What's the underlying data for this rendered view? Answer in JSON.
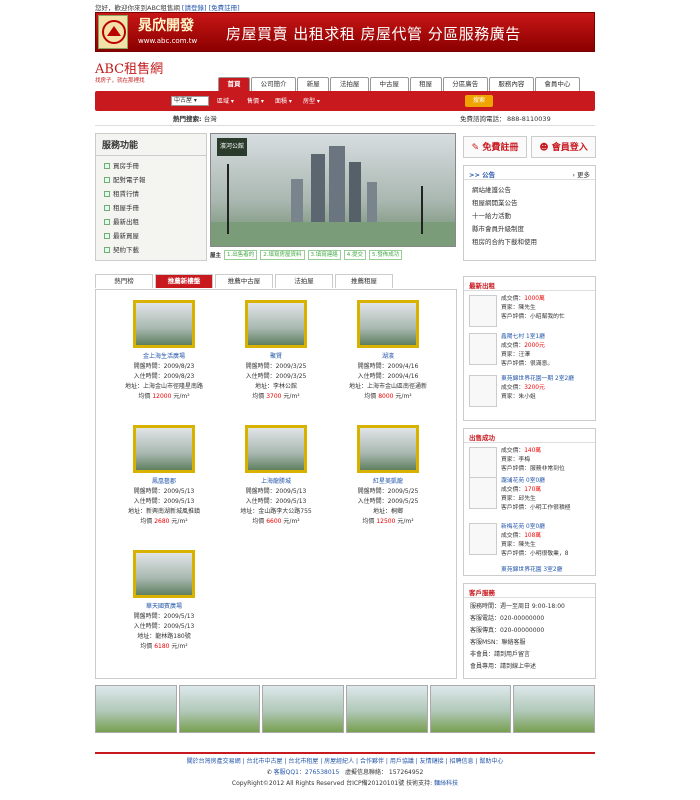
{
  "top": {
    "welcome": "您好，歡迎你來到ABC租售網",
    "login": "[請登錄]",
    "register": "[免費註冊]"
  },
  "banner": {
    "company": "晁欣開發",
    "site": "www.abc.com.tw",
    "slogan": "房屋買賣 出租求租 房屋代管 分區服務廣告"
  },
  "site": {
    "name": "ABC租售網",
    "slogan": "找房子，就在那裡找"
  },
  "nav": [
    "首頁",
    "公司簡介",
    "新屋",
    "法拍屋",
    "中古屋",
    "租屋",
    "分區廣告",
    "服務內容",
    "會員中心"
  ],
  "search": {
    "type": "中古屋",
    "area": "區域",
    "price": "售價",
    "size": "面積",
    "layout": "房型",
    "button": "搜索"
  },
  "hot": {
    "label": "熱門搜索:",
    "value": "台灣",
    "phone_label": "免費諮詢電話：",
    "phone": "888-8110039"
  },
  "services": {
    "title": "服務功能",
    "items": [
      "買房手冊",
      "配對電子報",
      "租賃行情",
      "租屋手冊",
      "最新出租",
      "最新買屋",
      "契約下載"
    ]
  },
  "slide": {
    "badge": "濱河公館"
  },
  "steps": [
    "屋主",
    "1.出售者的",
    "2.填寫房屋資料",
    "3.填寫連絡",
    "4.提交",
    "5.發佈成功"
  ],
  "reg": {
    "register": "免費註冊",
    "login": "會員登入"
  },
  "notice": {
    "title": ">> 公告",
    "more": "更多",
    "items": [
      "網站維護公告",
      "租屋網開業公告",
      "十一給力活動",
      "縣市會員升級制度",
      "租房的合約下載和使用"
    ]
  },
  "tabs": [
    "熱門榜",
    "推薦新樓盤",
    "推薦中古屋",
    "法拍屋",
    "推薦租屋"
  ],
  "listings": [
    {
      "name": "金上海生活廣場",
      "open": "開盤時間：2009/8/23",
      "move": "入住時間：2009/8/23",
      "addr": "地址：上海金山市徑隆星南路",
      "price": "均價",
      "value": "12000",
      "unit": "元/m²"
    },
    {
      "name": "聚賢",
      "open": "開盤時間：2009/3/25",
      "move": "入住時間：2009/3/25",
      "addr": "地址：李林公館",
      "price": "均價",
      "value": "3700",
      "unit": "元/m²"
    },
    {
      "name": "湖濱",
      "open": "開盤時間：2009/4/16",
      "move": "入住時間：2009/4/16",
      "addr": "地址：上海市金山區南徑通新",
      "price": "均價",
      "value": "8000",
      "unit": "元/m²"
    },
    {
      "name": "鳳凰藝郡",
      "open": "開盤時間：2009/5/13",
      "move": "入住時間：2009/5/13",
      "addr": "地址：新興南湖新城風推鎮",
      "price": "均價",
      "value": "2680",
      "unit": "元/m²"
    },
    {
      "name": "上海龍勝城",
      "open": "開盤時間：2009/5/13",
      "move": "入住時間：2009/5/13",
      "addr": "地址：金山路李大公路755",
      "price": "均價",
      "value": "6600",
      "unit": "元/m²"
    },
    {
      "name": "紅星美凱龍",
      "open": "開盤時間：2009/5/25",
      "move": "入住時間：2009/5/25",
      "addr": "地址：桐鄉",
      "price": "均價",
      "value": "12500",
      "unit": "元/m²"
    },
    {
      "name": "華天國賓廣場",
      "open": "開盤時間：2009/5/13",
      "move": "入住時間：2009/5/13",
      "addr": "地址：龍林路180號",
      "price": "均價",
      "value": "6180",
      "unit": "元/m²"
    }
  ],
  "latest_rent": {
    "title": "最新出租",
    "items": [
      {
        "l1": "成交價：",
        "price": "1000萬",
        "l2": "買家：陳先生",
        "l3": "客戶評價：小昭幫我的忙"
      },
      {
        "name": "鑫陽七村 1室1廳",
        "l1": "成交價：",
        "price": "2000元",
        "l2": "買家：汪澤",
        "l3": "客戶評價：很滿意。"
      },
      {
        "name": "東苑錦世界花園一期 2室2廳",
        "l1": "成交價：",
        "price": "3200元",
        "l2": "買家：朱小姐",
        "l3": ""
      }
    ]
  },
  "success": {
    "title": "出售成功",
    "items": [
      {
        "l1": "成交價：",
        "price": "140萬",
        "l2": "買家：李梅",
        "l3": "客戶評價：服務非常到位"
      },
      {
        "name": "瀧浦花苑 0室0廳",
        "l1": "成交價：",
        "price": "170萬",
        "l2": "買家：邱先生",
        "l3": "客戶評價：小明工作很積極"
      },
      {
        "name": "新梅花苑 0室0廳",
        "l1": "成交價：",
        "price": "108萬",
        "l2": "買家：陳先生",
        "l3": "客戶評價：小明很敬業，8"
      },
      {
        "name": "東苑錦世界花園 3室2廳",
        "l1": "",
        "price": "",
        "l2": "",
        "l3": ""
      }
    ]
  },
  "customer": {
    "title": "客戶服務",
    "rows": [
      "服務時間：週一至周日 9:00-18:00",
      "客服電話：020-00000000",
      "客服傳真：020-00000000",
      "客服MSN：聯絡客服",
      "非會員：請到用戶留言",
      "會員專用：請到線上申述"
    ]
  },
  "footer": {
    "links": "關於台灣房產交易網 | 台北市中古屋 | 台北市租屋 | 房屋經紀人 | 合作夥伴 | 用戶協議 | 友情鏈接 | 招聘信息 | 幫助中心",
    "qq": "客服QQ1：276538015",
    "fax": "虛擬信息聯絡： 157264952",
    "copy": "CopyRight©2012 All Rights Reserved 台ICP備20120101號 技術支持:",
    "tech": "麵絲科技"
  },
  "colors": {
    "accent": "#c8191f",
    "link": "#2255aa",
    "price": "#ee0000"
  }
}
